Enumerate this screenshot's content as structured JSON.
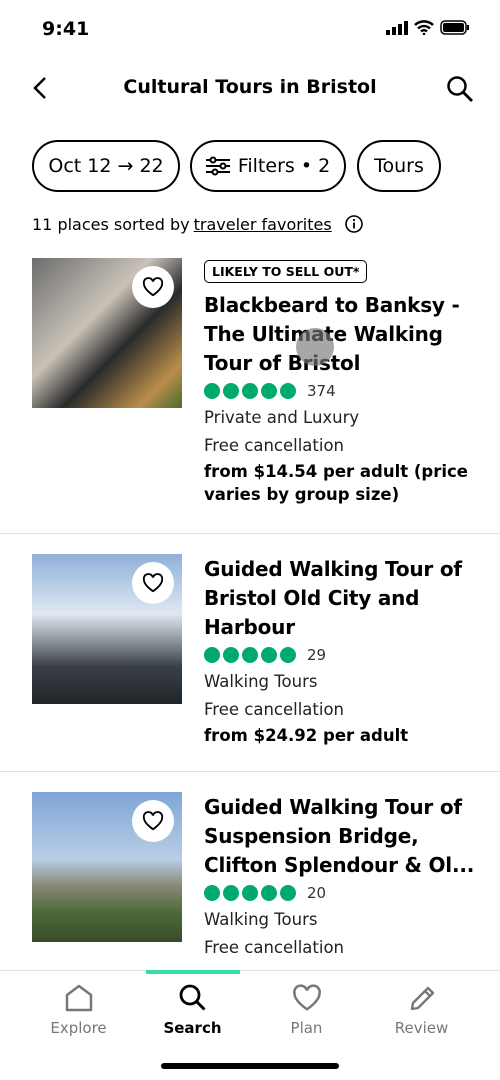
{
  "status": {
    "time": "9:41"
  },
  "header": {
    "title": "Cultural Tours in Bristol"
  },
  "chips": {
    "dates": "Oct 12 → 22",
    "filters": "Filters • 2",
    "tours": "Tours"
  },
  "sort": {
    "prefix": "11 places sorted by",
    "link": "traveler favorites"
  },
  "results": [
    {
      "badge": "LIKELY TO SELL OUT*",
      "title": "Blackbeard to Banksy - The Ultimate Walking Tour of Bristol",
      "rating": 5,
      "reviews": "374",
      "category": "Private and Luxury",
      "cancellation": "Free cancellation",
      "price": "from $14.54 per adult (price varies by group size)"
    },
    {
      "title": "Guided Walking Tour of Bristol Old City and Harbour",
      "rating": 5,
      "reviews": "29",
      "category": "Walking Tours",
      "cancellation": "Free cancellation",
      "price": "from $24.92 per adult"
    },
    {
      "title": "Guided Walking Tour of Suspension Bridge, Clifton Splendour & Ol...",
      "rating": 5,
      "reviews": "20",
      "category": "Walking Tours",
      "cancellation": "Free cancellation"
    }
  ],
  "tabs": [
    {
      "label": "Explore",
      "icon": "home-icon"
    },
    {
      "label": "Search",
      "icon": "search-icon",
      "active": true
    },
    {
      "label": "Plan",
      "icon": "heart-icon"
    },
    {
      "label": "Review",
      "icon": "pencil-icon"
    }
  ],
  "colors": {
    "rating": "#00aa6c",
    "tab_indicator": "#34e0a1"
  }
}
